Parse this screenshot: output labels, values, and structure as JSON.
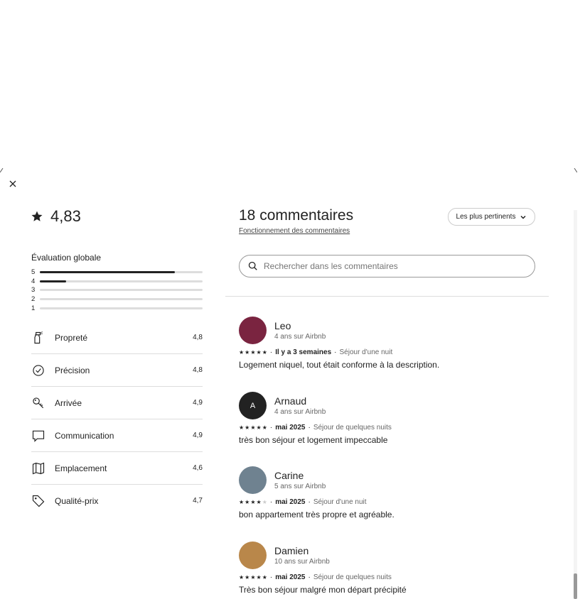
{
  "close_icon": "close-icon",
  "summary": {
    "rating": "4,83",
    "overall_label": "Évaluation globale",
    "distribution": [
      {
        "stars": "5",
        "fraction": 0.83
      },
      {
        "stars": "4",
        "fraction": 0.16
      },
      {
        "stars": "3",
        "fraction": 0
      },
      {
        "stars": "2",
        "fraction": 0
      },
      {
        "stars": "1",
        "fraction": 0
      }
    ],
    "categories": [
      {
        "name": "Propreté",
        "value": "4,8",
        "icon": "spray-bottle-icon"
      },
      {
        "name": "Précision",
        "value": "4,8",
        "icon": "check-circle-icon"
      },
      {
        "name": "Arrivée",
        "value": "4,9",
        "icon": "key-icon"
      },
      {
        "name": "Communication",
        "value": "4,9",
        "icon": "chat-bubble-icon"
      },
      {
        "name": "Emplacement",
        "value": "4,6",
        "icon": "map-icon"
      },
      {
        "name": "Qualité-prix",
        "value": "4,7",
        "icon": "tag-icon"
      }
    ]
  },
  "reviews_panel": {
    "title": "18 commentaires",
    "how_link": "Fonctionnement des commentaires",
    "sort_label": "Les plus pertinents",
    "search_placeholder": "Rechercher dans les commentaires"
  },
  "reviews": [
    {
      "name": "Leo",
      "since": "4 ans sur Airbnb",
      "stars": 5,
      "when": "Il y a 3 semaines",
      "stay": "Séjour d'une nuit",
      "text": "Logement niquel, tout était conforme à la description.",
      "avatar_initial": "",
      "avatar_color": "#7a2440"
    },
    {
      "name": "Arnaud",
      "since": "4 ans sur Airbnb",
      "stars": 5,
      "when": "mai 2025",
      "stay": "Séjour de quelques nuits",
      "text": "très bon séjour et logement impeccable",
      "avatar_initial": "A",
      "avatar_color": "#222222"
    },
    {
      "name": "Carine",
      "since": "5 ans sur Airbnb",
      "stars": 4,
      "when": "mai 2025",
      "stay": "Séjour d'une nuit",
      "text": "bon appartement très propre et agréable.",
      "avatar_initial": "",
      "avatar_color": "#6f8290"
    },
    {
      "name": "Damien",
      "since": "10 ans sur Airbnb",
      "stars": 5,
      "when": "mai 2025",
      "stay": "Séjour de quelques nuits",
      "text": "Très bon séjour malgré mon départ précipité",
      "avatar_initial": "",
      "avatar_color": "#b9874a"
    }
  ]
}
